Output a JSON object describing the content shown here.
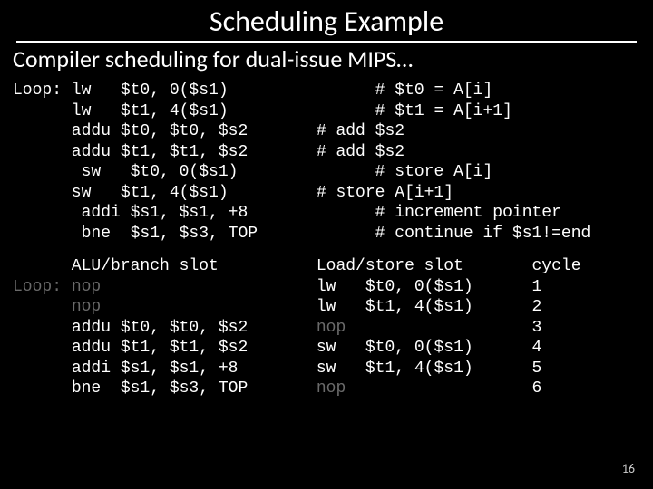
{
  "title": "Scheduling Example",
  "subtitle": "Compiler scheduling for dual-issue MIPS…",
  "page_number": "16",
  "loop_label": "Loop:",
  "top_code": [
    {
      "label": "Loop:",
      "instr": "lw   $t0, 0($s1)",
      "comment": "      # $t0 = A[i]"
    },
    {
      "label": "     ",
      "instr": "lw   $t1, 4($s1)",
      "comment": "      # $t1 = A[i+1]"
    },
    {
      "label": "     ",
      "instr": "addu $t0, $t0, $s2",
      "comment": "# add $s2"
    },
    {
      "label": "     ",
      "instr": "addu $t1, $t1, $s2",
      "comment": "# add $s2"
    },
    {
      "label": "     ",
      "instr": " sw   $t0, 0($s1)",
      "comment": "      # store A[i]"
    },
    {
      "label": "     ",
      "instr": "sw   $t1, 4($s1)  ",
      "comment": "# store A[i+1]"
    },
    {
      "label": "     ",
      "instr": " addi $s1, $s1, +8 ",
      "comment": "      # increment pointer"
    },
    {
      "label": "     ",
      "instr": " bne  $s1, $s3, TOP",
      "comment": "      # continue if $s1!=end"
    }
  ],
  "schedule": {
    "header": {
      "alu": "ALU/branch slot",
      "ls": "Load/store slot",
      "cycle": "cycle"
    },
    "rows": [
      {
        "label": "Loop:",
        "alu": "nop               ",
        "alu_ghost": true,
        "ls": "lw   $t0, 0($s1)",
        "ls_ghost": false,
        "cycle": "1"
      },
      {
        "label": "     ",
        "alu": "nop               ",
        "alu_ghost": true,
        "ls": "lw   $t1, 4($s1)",
        "ls_ghost": false,
        "cycle": "2"
      },
      {
        "label": "     ",
        "alu": "addu $t0, $t0, $s2",
        "alu_ghost": false,
        "ls": "nop             ",
        "ls_ghost": true,
        "cycle": "3"
      },
      {
        "label": "     ",
        "alu": "addu $t1, $t1, $s2",
        "alu_ghost": false,
        "ls": "sw   $t0, 0($s1)",
        "ls_ghost": false,
        "cycle": "4"
      },
      {
        "label": "     ",
        "alu": "addi $s1, $s1, +8 ",
        "alu_ghost": false,
        "ls": "sw   $t1, 4($s1)",
        "ls_ghost": false,
        "cycle": "5"
      },
      {
        "label": "     ",
        "alu": "bne  $s1, $s3, TOP",
        "alu_ghost": false,
        "ls": "nop             ",
        "ls_ghost": true,
        "cycle": "6"
      }
    ]
  }
}
